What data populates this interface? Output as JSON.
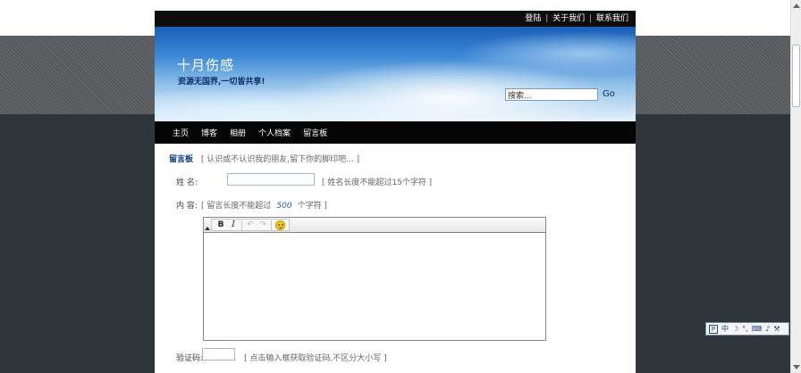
{
  "topbar": {
    "links": [
      "登陆",
      "关于我们",
      "联系我们"
    ],
    "separator": "|"
  },
  "header": {
    "title": "十月伤感",
    "subtitle": "资源无国界,一切皆共享!",
    "search": {
      "value": "搜索...",
      "go_label": "Go"
    }
  },
  "nav": {
    "items": [
      "主页",
      "博客",
      "相册",
      "个人档案",
      "留言板"
    ]
  },
  "guestbook": {
    "title": "留言板",
    "note": "[ 认识或不认识我的朋友,留下你的脚印吧... ]",
    "name_label": "姓    名:",
    "name_note": "[ 姓名长度不能超过15个字符 ]",
    "content_label": "内    容:",
    "content_note_prefix": "[ 留言长度不能超过",
    "content_limit": "500",
    "content_note_suffix": "个字符 ]",
    "editor": {
      "tools": [
        "bold-icon",
        "italic-icon",
        "undo-icon",
        "redo-icon",
        "smiley-icon"
      ],
      "bold_label": "B",
      "italic_label": "I",
      "undo_label": "↶",
      "redo_label": "↷"
    },
    "captcha_label": "验证码:",
    "captcha_note": "[ 点击输入框获取验证码,不区分大小写 ]"
  },
  "ime": {
    "logo": "P",
    "items": [
      "中",
      "☽",
      "°,",
      "⌨",
      "♪",
      "⚒"
    ]
  },
  "colors": {
    "page_bg_dark": "#2e363b",
    "nav_bg": "#050505",
    "title_blue": "#0a3a7a"
  }
}
